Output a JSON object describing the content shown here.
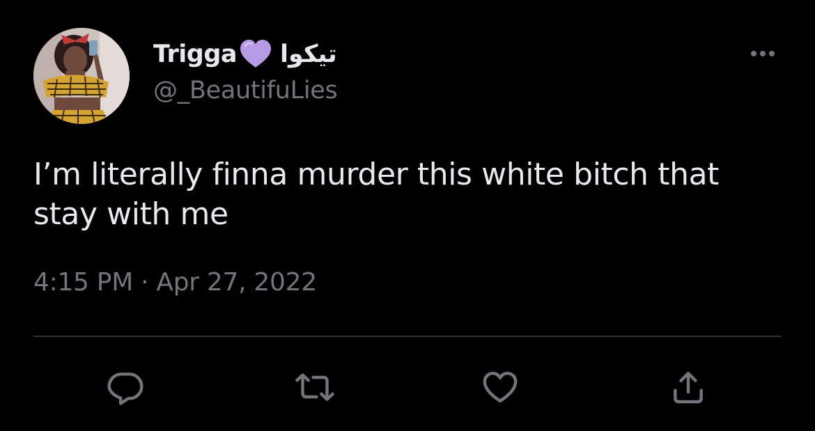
{
  "tweet": {
    "display_name": "Trigga",
    "display_name_arabic": "تيكوا",
    "handle": "@_BeautifuLies",
    "text_line1": "I’m literally finna murder this white bitch that",
    "text_line2": "stay with me",
    "timestamp": "4:15 PM · Apr 27, 2022"
  },
  "icons": {
    "more": "more-horizontal-icon",
    "heart_emoji": "purple-heart-emoji",
    "reply": "reply-icon",
    "retweet": "retweet-icon",
    "like": "like-icon",
    "share": "share-icon"
  },
  "colors": {
    "background": "#000000",
    "primary_text": "#e7e9ea",
    "secondary_text": "#71767b",
    "divider": "#2f3336",
    "purple_heart": "#b79be6"
  }
}
